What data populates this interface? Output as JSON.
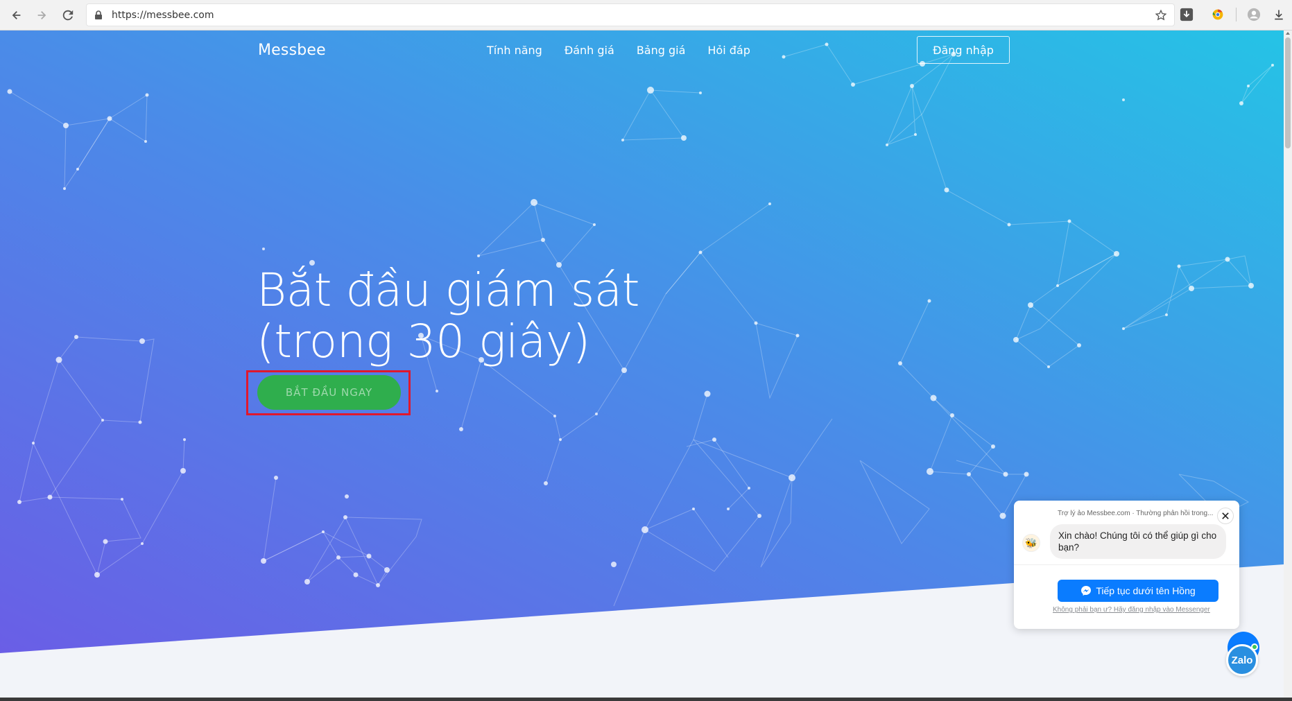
{
  "browser": {
    "url": "https://messbee.com",
    "icons": [
      "back-arrow-icon",
      "forward-arrow-icon",
      "reload-icon",
      "lock-icon",
      "star-icon",
      "download-extension-icon",
      "chrome-extension-icon",
      "profile-icon",
      "download-icon"
    ]
  },
  "nav": {
    "brand": "Messbee",
    "items": [
      "Tính năng",
      "Đánh giá",
      "Bảng giá",
      "Hỏi đáp"
    ],
    "login": "Đăng nhập"
  },
  "hero": {
    "line1": "Bắt đầu giám sát",
    "line2": "(trong 30 giây)",
    "cta": "BẮT ĐẦU NGAY",
    "gradient_start": "#6a5ee6",
    "gradient_end": "#25c0e6",
    "cta_color": "#2fae4d",
    "highlight_color": "#e0182d"
  },
  "chat": {
    "meta": "Trợ lý ảo Messbee.com · Thường phản hồi trong...",
    "greeting": "Xin chào! Chúng tôi có thể giúp gì cho bạn?",
    "continue": "Tiếp tục dưới tên Hồng",
    "not_you": "Không phải bạn ư? Hãy đăng nhập vào Messenger",
    "accent": "#0a7cff"
  },
  "zalo": {
    "label": "Zalo"
  }
}
